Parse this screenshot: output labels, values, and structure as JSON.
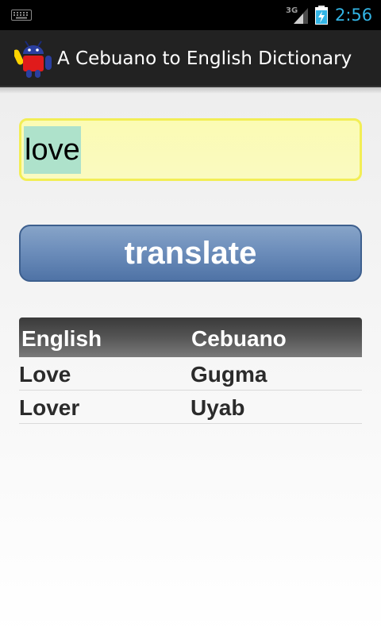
{
  "status_bar": {
    "network": "3G",
    "time": "2:56",
    "icons": [
      "keyboard-icon",
      "signal-icon",
      "battery-charging-icon"
    ],
    "clock_color": "#33b5e5"
  },
  "action_bar": {
    "title": "A Cebuano to English Dictionary",
    "icon": "android-app-icon"
  },
  "search": {
    "value": "love"
  },
  "translate_button": {
    "label": "translate",
    "color": "#5f80b0"
  },
  "results": {
    "headers": [
      "English",
      "Cebuano"
    ],
    "rows": [
      [
        "Love",
        "Gugma"
      ],
      [
        "Lover",
        "Uyab"
      ]
    ]
  }
}
